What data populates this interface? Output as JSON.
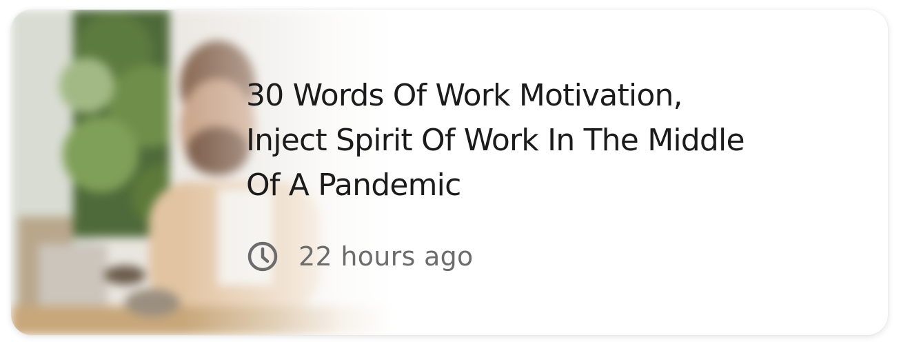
{
  "article": {
    "title_lines": [
      "30 Words Of Work Motivation,",
      "Inject Spirit Of Work In The Middle",
      "Of A Pandemic"
    ],
    "timestamp": "22 hours ago",
    "timestamp_icon": "clock-icon",
    "thumbnail": "blurred-photo-man-with-laptop-and-plants"
  },
  "colors": {
    "title": "#1b1b1b",
    "timestamp": "#6c6c6c",
    "card_background": "#ffffff"
  }
}
